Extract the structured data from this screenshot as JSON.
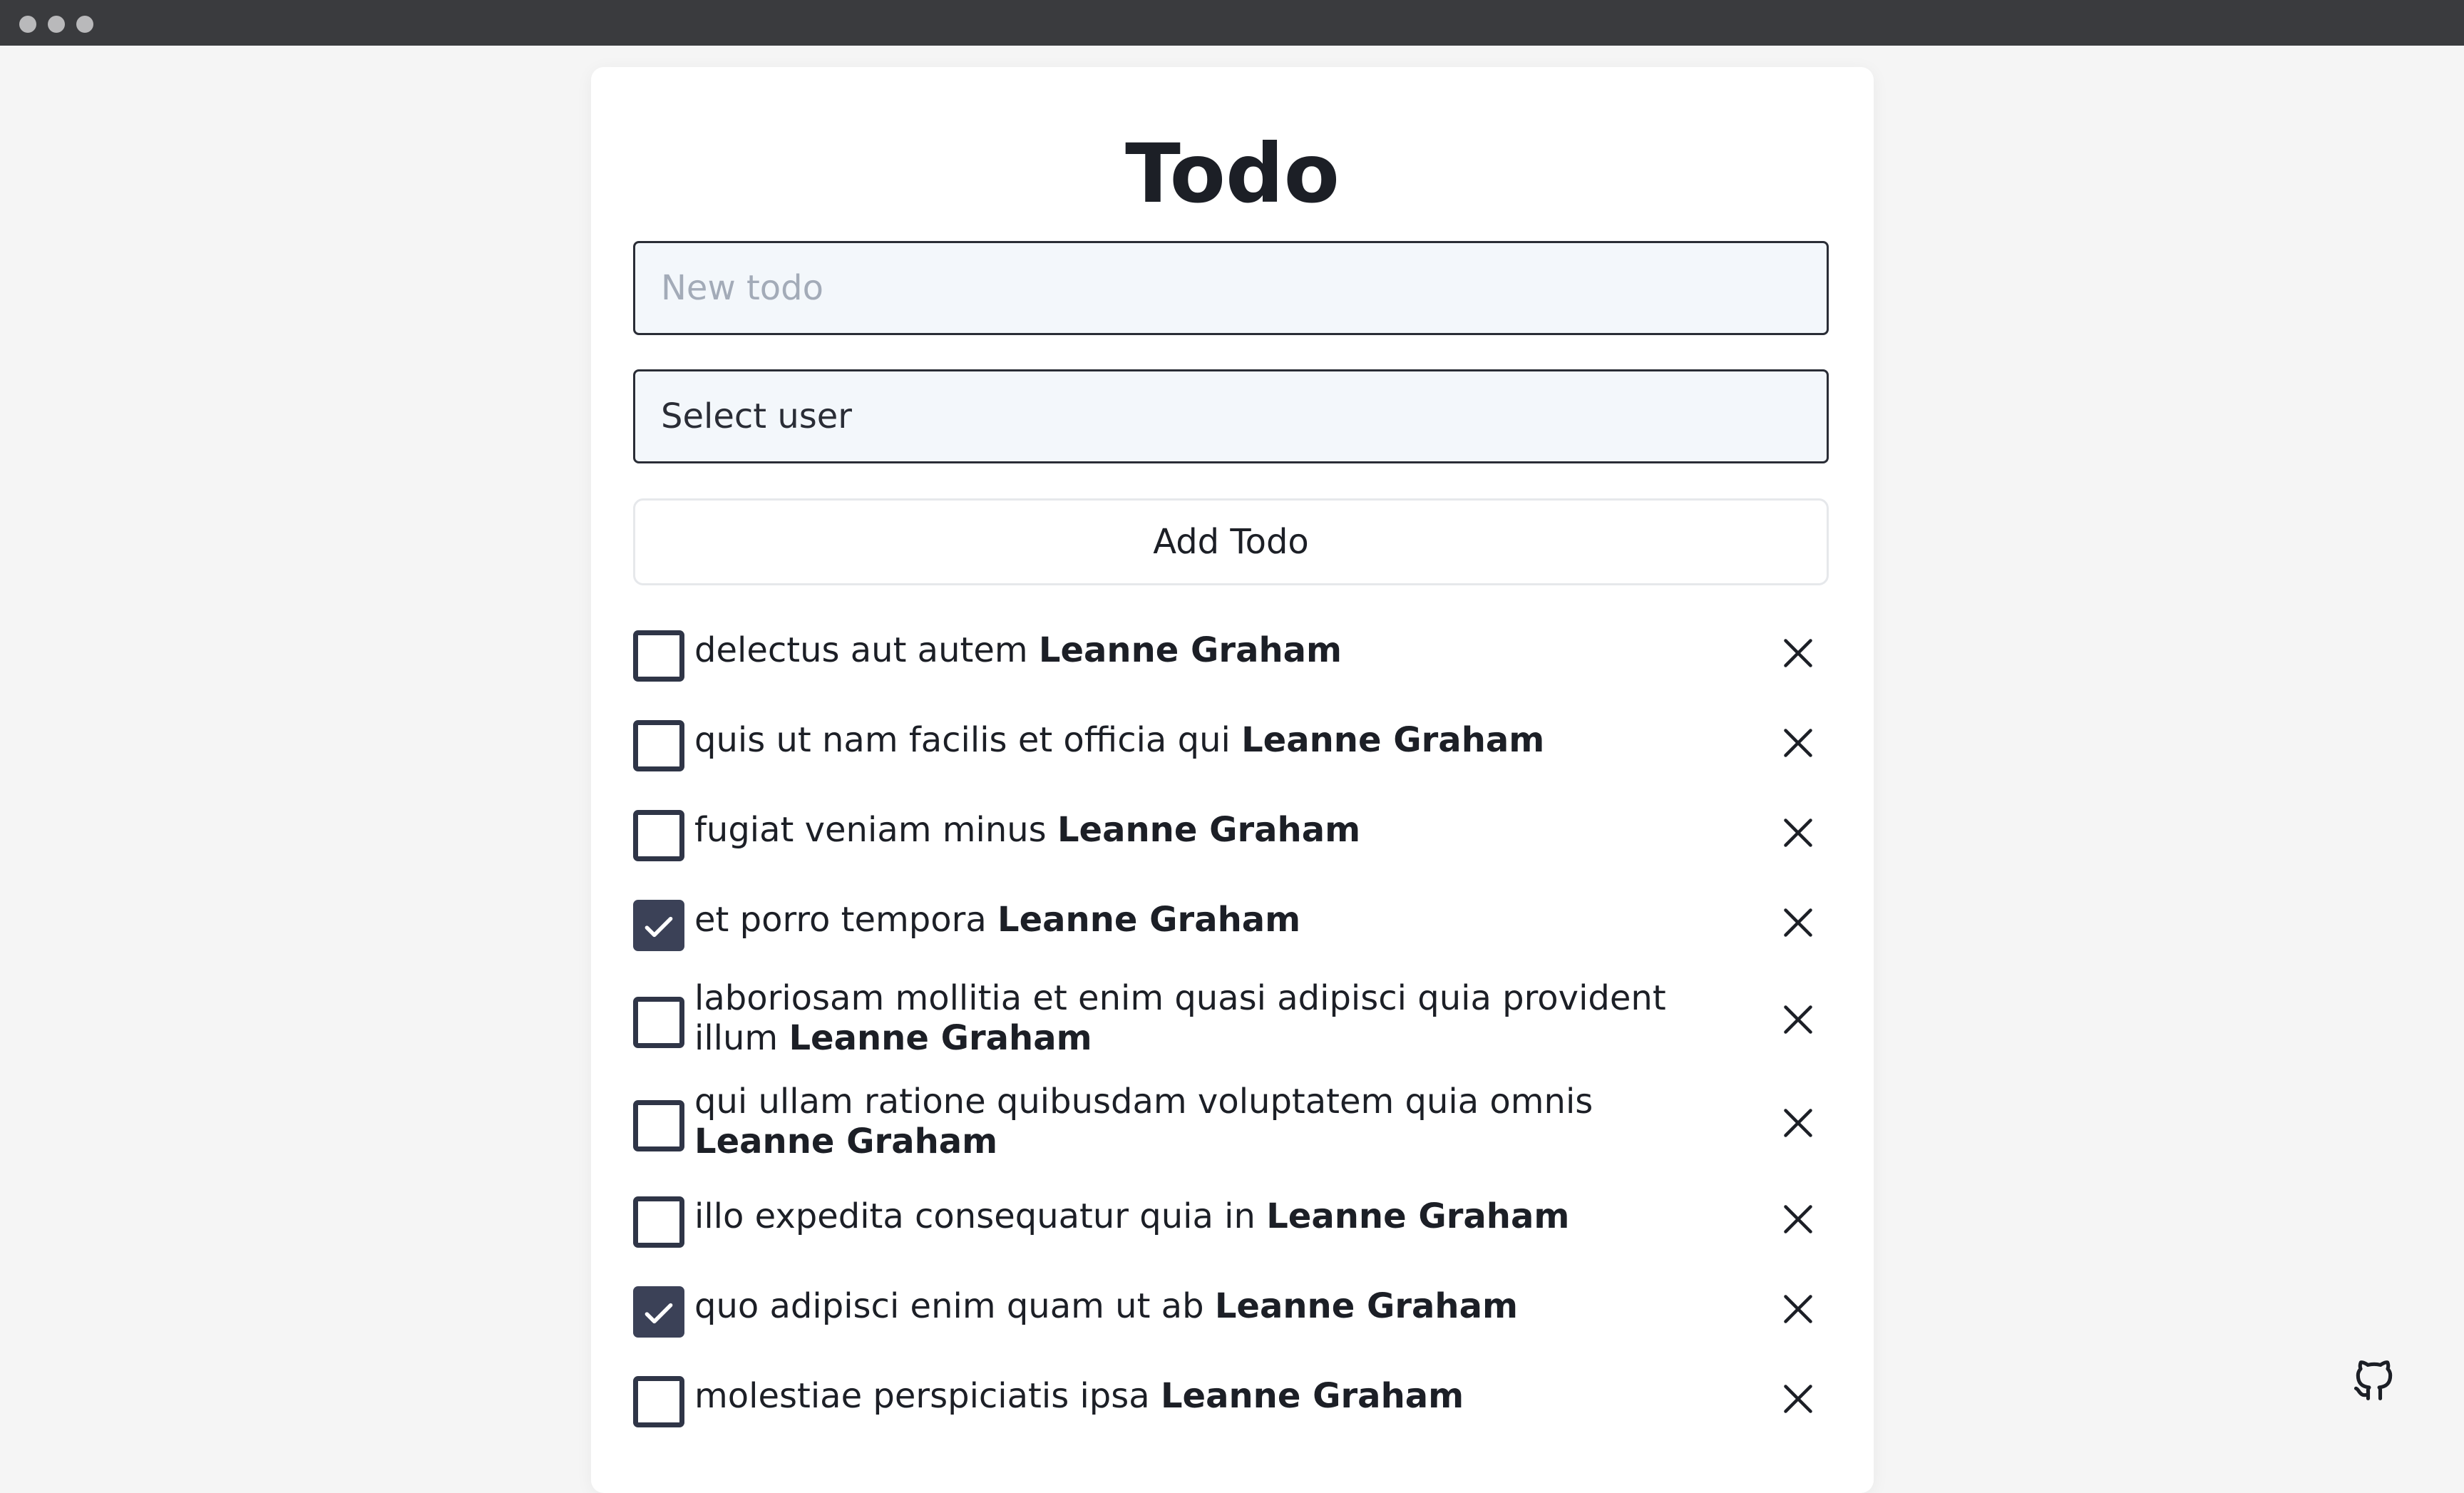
{
  "app": {
    "title": "Todo"
  },
  "form": {
    "new_todo_placeholder": "New todo",
    "new_todo_value": "",
    "select_user_value": "Select user",
    "add_button_label": "Add Todo"
  },
  "todos": [
    {
      "text": "delectus aut autem",
      "user": "Leanne Graham",
      "done": false
    },
    {
      "text": "quis ut nam facilis et officia qui",
      "user": "Leanne Graham",
      "done": false
    },
    {
      "text": "fugiat veniam minus",
      "user": "Leanne Graham",
      "done": false
    },
    {
      "text": "et porro tempora",
      "user": "Leanne Graham",
      "done": true
    },
    {
      "text": "laboriosam mollitia et enim quasi adipisci quia provident illum",
      "user": "Leanne Graham",
      "done": false
    },
    {
      "text": "qui ullam ratione quibusdam voluptatem quia omnis",
      "user": "Leanne Graham",
      "done": false
    },
    {
      "text": "illo expedita consequatur quia in",
      "user": "Leanne Graham",
      "done": false
    },
    {
      "text": "quo adipisci enim quam ut ab",
      "user": "Leanne Graham",
      "done": true
    },
    {
      "text": "molestiae perspiciatis ipsa",
      "user": "Leanne Graham",
      "done": false
    }
  ],
  "icons": {
    "check": "check-icon",
    "delete": "close-icon",
    "github": "github-icon"
  },
  "colors": {
    "accent": "#3b4157",
    "text": "#1c1f26",
    "input_bg": "#f3f7fb"
  }
}
